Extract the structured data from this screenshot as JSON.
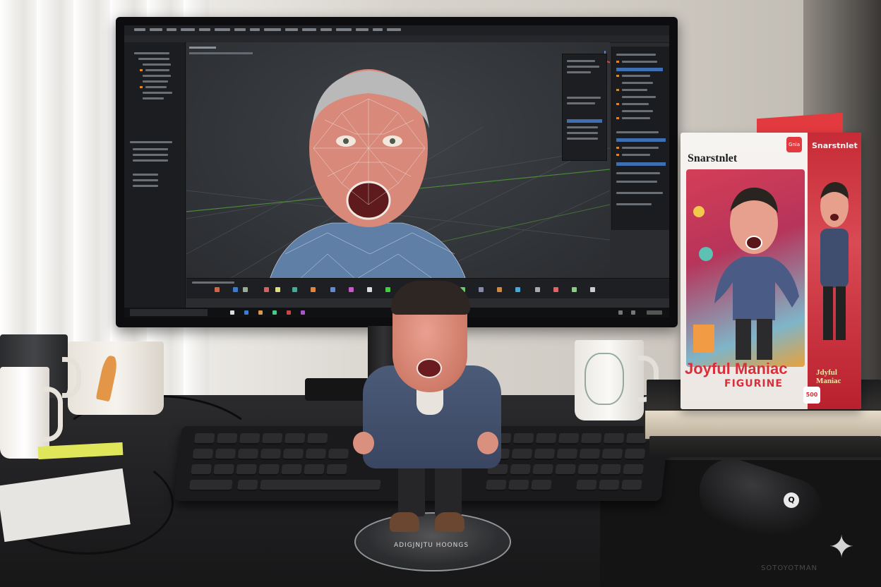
{
  "figurine_box": {
    "brand": "Snarstnlet",
    "side_brand": "Snarstnlet",
    "corner_badge": "Gnia",
    "title": "Joyful Maniac",
    "subtitle": "FIGURINE",
    "side_title": "Jdyful Maniac",
    "side_badge": "500"
  },
  "figurine_base": {
    "engraving": "ADIGJNJTU HOONGS"
  },
  "mouse": {
    "logo": "Q"
  },
  "desk_mat": {
    "brand": "SOTOYOTMAN"
  },
  "colors": {
    "box_red": "#d92f3b",
    "viewport_grid": "#4c8a3a",
    "selection_blue": "#3f6fb3"
  },
  "icons": {
    "watermark": "sparkle-icon"
  }
}
